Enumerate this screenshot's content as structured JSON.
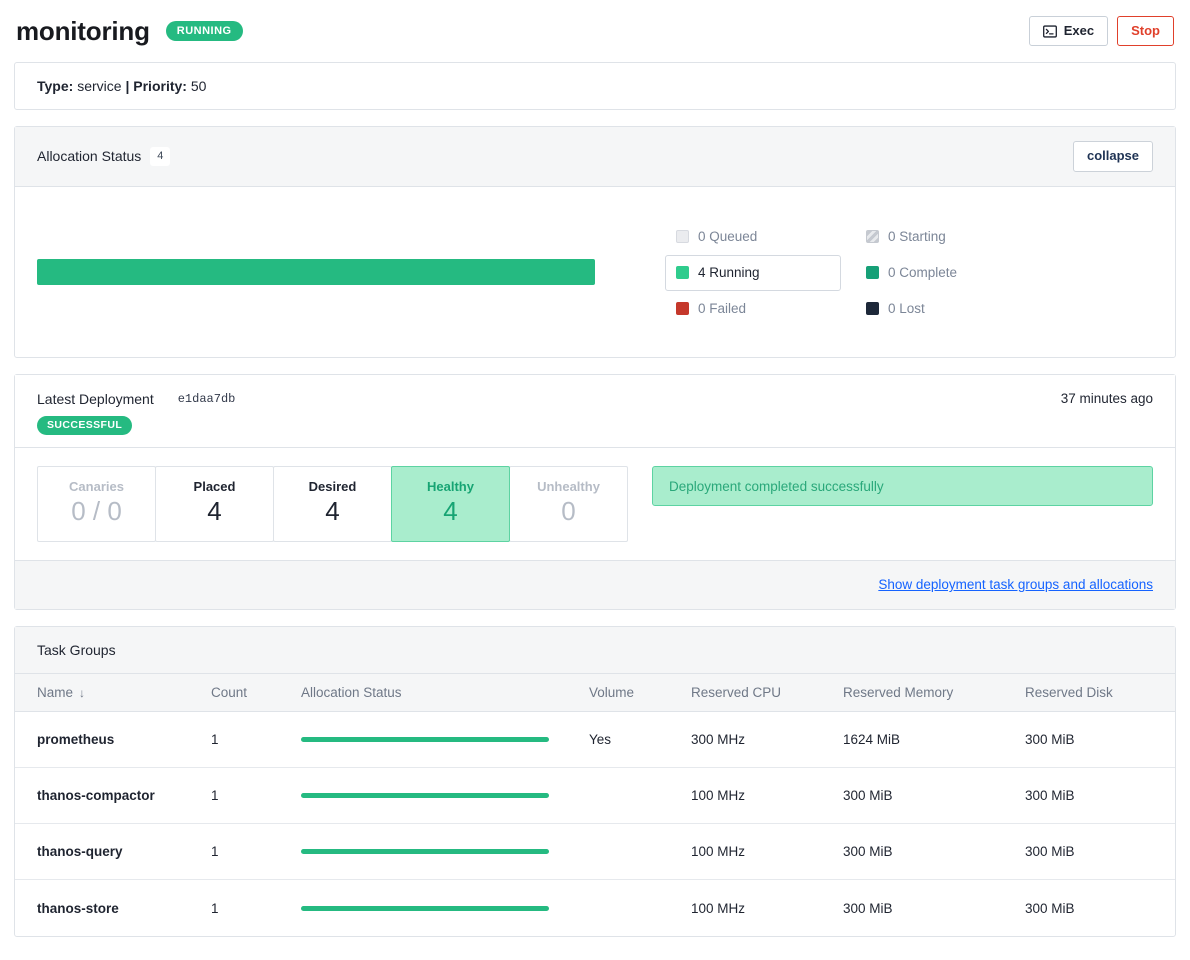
{
  "header": {
    "title": "monitoring",
    "status_badge": "RUNNING",
    "exec_label": "Exec",
    "stop_label": "Stop"
  },
  "meta_bar": {
    "type_label": "Type:",
    "type_value": "service",
    "separator": "|",
    "priority_label": "Priority:",
    "priority_value": "50"
  },
  "allocation_status": {
    "title": "Allocation Status",
    "count": "4",
    "collapse_label": "collapse",
    "legend": [
      {
        "label": "0 Queued",
        "swatch": "sw-queued",
        "active": false
      },
      {
        "label": "0 Starting",
        "swatch": "sw-starting",
        "active": false
      },
      {
        "label": "4 Running",
        "swatch": "sw-running",
        "active": true
      },
      {
        "label": "0 Complete",
        "swatch": "sw-complete",
        "active": false
      },
      {
        "label": "0 Failed",
        "swatch": "sw-failed",
        "active": false
      },
      {
        "label": "0 Lost",
        "swatch": "sw-lost",
        "active": false
      }
    ]
  },
  "deployment": {
    "title": "Latest Deployment",
    "id": "e1daa7db",
    "status_badge": "SUCCESSFUL",
    "time_ago": "37 minutes ago",
    "metrics": [
      {
        "label": "Canaries",
        "value": "0 / 0",
        "state": "muted"
      },
      {
        "label": "Placed",
        "value": "4",
        "state": "normal"
      },
      {
        "label": "Desired",
        "value": "4",
        "state": "normal"
      },
      {
        "label": "Healthy",
        "value": "4",
        "state": "healthy"
      },
      {
        "label": "Unhealthy",
        "value": "0",
        "state": "muted"
      }
    ],
    "note": "Deployment completed successfully",
    "show_link": "Show deployment task groups and allocations"
  },
  "task_groups": {
    "title": "Task Groups",
    "columns": [
      "Name",
      "Count",
      "Allocation Status",
      "Volume",
      "Reserved CPU",
      "Reserved Memory",
      "Reserved Disk"
    ],
    "sort_icon": "↓",
    "rows": [
      {
        "name": "prometheus",
        "count": "1",
        "volume": "Yes",
        "cpu": "300 MHz",
        "memory": "1624 MiB",
        "disk": "300 MiB"
      },
      {
        "name": "thanos-compactor",
        "count": "1",
        "volume": "",
        "cpu": "100 MHz",
        "memory": "300 MiB",
        "disk": "300 MiB"
      },
      {
        "name": "thanos-query",
        "count": "1",
        "volume": "",
        "cpu": "100 MHz",
        "memory": "300 MiB",
        "disk": "300 MiB"
      },
      {
        "name": "thanos-store",
        "count": "1",
        "volume": "",
        "cpu": "100 MHz",
        "memory": "300 MiB",
        "disk": "300 MiB"
      }
    ]
  },
  "colors": {
    "green": "#25ba81",
    "green_light": "#a9edcd",
    "red": "#e0402b",
    "link_blue": "#1563ff"
  }
}
